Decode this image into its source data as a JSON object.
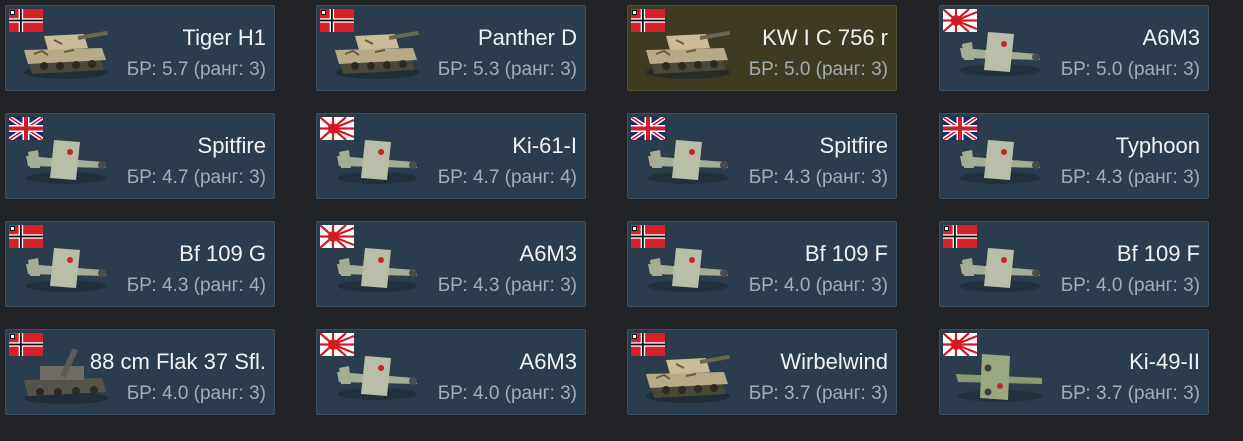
{
  "cards": [
    {
      "nation": "germany",
      "kind": "tank",
      "name": "Tiger H1",
      "br": "БР: 5.7 (ранг: 3)"
    },
    {
      "nation": "germany",
      "kind": "tank",
      "name": "Panther D",
      "br": "БР: 5.3 (ранг: 3)"
    },
    {
      "nation": "germany",
      "kind": "tank",
      "name": "KW I C 756 r",
      "br": "БР: 5.0 (ранг: 3)",
      "highlighted": true
    },
    {
      "nation": "japan",
      "kind": "plane",
      "name": "A6M3",
      "br": "БР: 5.0 (ранг: 3)"
    },
    {
      "nation": "uk",
      "kind": "plane",
      "name": "Spitfire",
      "br": "БР: 4.7 (ранг: 3)"
    },
    {
      "nation": "japan",
      "kind": "plane",
      "name": "Ki-61-I",
      "br": "БР: 4.7 (ранг: 4)"
    },
    {
      "nation": "uk",
      "kind": "plane",
      "name": "Spitfire",
      "br": "БР: 4.3 (ранг: 3)"
    },
    {
      "nation": "uk",
      "kind": "plane",
      "name": "Typhoon",
      "br": "БР: 4.3 (ранг: 3)"
    },
    {
      "nation": "germany",
      "kind": "plane",
      "name": "Bf 109 G",
      "br": "БР: 4.3 (ранг: 4)"
    },
    {
      "nation": "japan",
      "kind": "plane",
      "name": "A6M3",
      "br": "БР: 4.3 (ранг: 3)"
    },
    {
      "nation": "germany",
      "kind": "plane",
      "name": "Bf 109 F",
      "br": "БР: 4.0 (ранг: 3)"
    },
    {
      "nation": "germany",
      "kind": "plane",
      "name": "Bf 109 F",
      "br": "БР: 4.0 (ранг: 3)"
    },
    {
      "nation": "germany",
      "kind": "spaa",
      "name": "88 cm Flak 37 Sfl.",
      "br": "БР: 4.0 (ранг: 3)"
    },
    {
      "nation": "japan",
      "kind": "plane",
      "name": "A6M3",
      "br": "БР: 4.0 (ранг: 3)"
    },
    {
      "nation": "germany",
      "kind": "tank",
      "name": "Wirbelwind",
      "br": "БР: 3.7 (ранг: 3)"
    },
    {
      "nation": "japan",
      "kind": "bomber",
      "name": "Ki-49-II",
      "br": "БР: 3.7 (ранг: 3)"
    }
  ]
}
